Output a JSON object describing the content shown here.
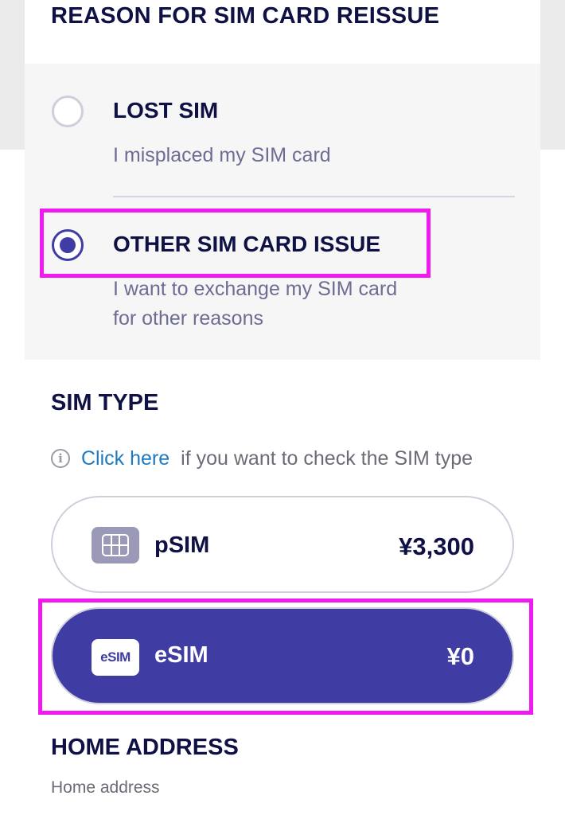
{
  "reason_section": {
    "title": "REASON FOR SIM CARD REISSUE",
    "options": [
      {
        "title": "LOST SIM",
        "description": "I misplaced my SIM card",
        "selected": false
      },
      {
        "title": "OTHER SIM CARD ISSUE",
        "description_line1": "I want to exchange my SIM card",
        "description_line2": "for other reasons",
        "selected": true
      }
    ]
  },
  "sim_type_section": {
    "title": "SIM TYPE",
    "info_link": "Click here",
    "info_text": "if you want to check the SIM type",
    "options": [
      {
        "label": "pSIM",
        "price": "¥3,300",
        "icon": "physical-sim-card-icon",
        "selected": false
      },
      {
        "label": "eSIM",
        "icon_text": "eSIM",
        "price": "¥0",
        "icon": "esim-icon",
        "selected": true
      }
    ]
  },
  "home_address_section": {
    "title": "HOME ADDRESS",
    "field_label": "Home address"
  },
  "colors": {
    "accent": "#3f3ca4",
    "heading": "#0f1044",
    "link": "#1f7ac0",
    "highlight": "#f01af0"
  }
}
